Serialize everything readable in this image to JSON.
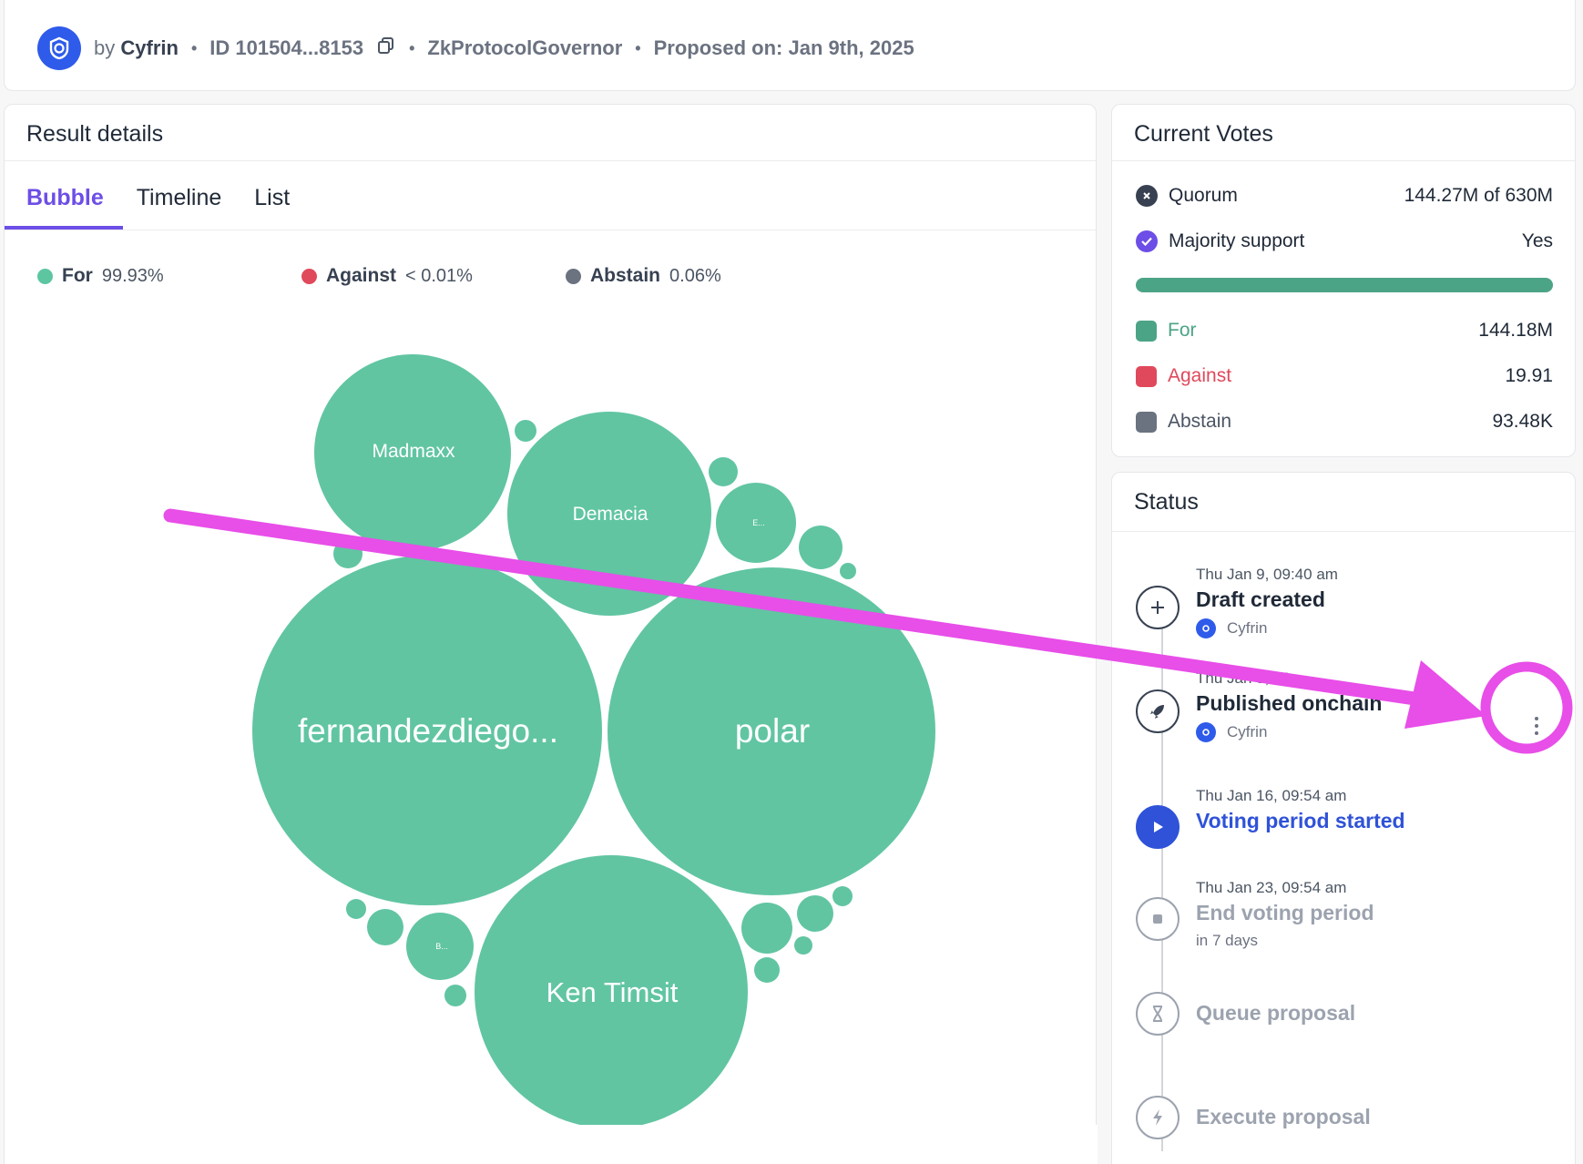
{
  "header": {
    "by_prefix": "by",
    "author": "Cyfrin",
    "id_text": "ID 101504...8153",
    "governor": "ZkProtocolGovernor",
    "proposed": "Proposed on: Jan 9th, 2025",
    "icons": [
      "cyfrin-logo-icon",
      "copy-icon"
    ]
  },
  "result": {
    "title": "Result details",
    "tabs": [
      "Bubble",
      "Timeline",
      "List"
    ],
    "active_tab": "Bubble",
    "legend": [
      {
        "label": "For",
        "value": "99.93%",
        "color": "#5dc6a1"
      },
      {
        "label": "Against",
        "value": "< 0.01%",
        "color": "#e0495b"
      },
      {
        "label": "Abstain",
        "value": "0.06%",
        "color": "#6b7280"
      }
    ],
    "bubble_color": "#61c5a2"
  },
  "chart_data": {
    "type": "bubble",
    "labeled_bubbles": [
      "fernandezdiego...",
      "polar",
      "Ken Timsit",
      "Demacia",
      "Madmaxx"
    ],
    "small_labels": [
      "E...",
      "B..."
    ]
  },
  "votes": {
    "title": "Current Votes",
    "quorum_label": "Quorum",
    "quorum_value": "144.27M of 630M",
    "majority_label": "Majority support",
    "majority_value": "Yes",
    "for_label": "For",
    "for_value": "144.18M",
    "against_label": "Against",
    "against_value": "19.91",
    "abstain_label": "Abstain",
    "abstain_value": "93.48K",
    "colors": {
      "for": "#4ca486",
      "against": "#e0495b",
      "abstain": "#6b7280"
    }
  },
  "status": {
    "title": "Status",
    "steps": [
      {
        "date": "Thu Jan 9, 09:40 am",
        "title": "Draft created",
        "sub": "Cyfrin",
        "icon": "plus-icon"
      },
      {
        "date": "Thu Jan 9, 09:...",
        "title": "Published onchain",
        "sub": "Cyfrin",
        "icon": "rocket-icon"
      },
      {
        "date": "Thu Jan 16, 09:54 am",
        "title": "Voting period started",
        "sub": "",
        "icon": "play-icon"
      },
      {
        "date": "Thu Jan 23, 09:54 am",
        "title": "End voting period",
        "sub": "in 7 days",
        "icon": "stop-icon"
      },
      {
        "date": "",
        "title": "Queue proposal",
        "sub": "",
        "icon": "hourglass-icon"
      },
      {
        "date": "",
        "title": "Execute proposal",
        "sub": "",
        "icon": "lightning-icon"
      }
    ],
    "menu_icon": "kebab-menu-icon"
  },
  "annotation": {
    "color": "#e84ee8"
  }
}
